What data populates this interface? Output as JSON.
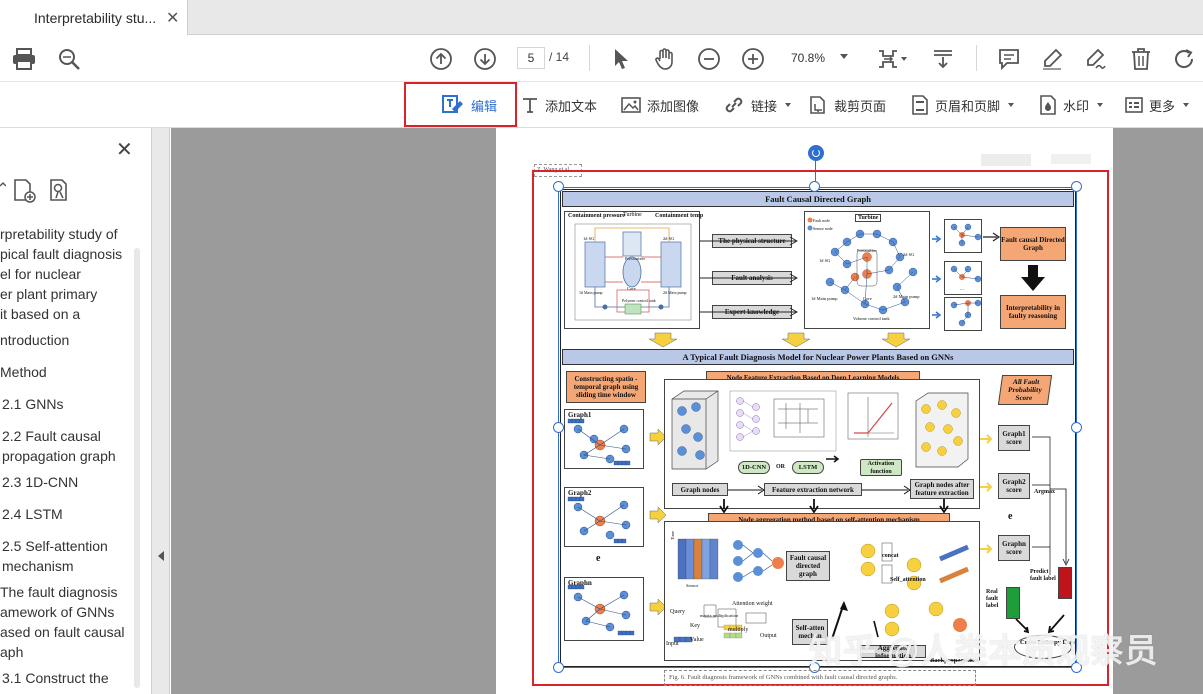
{
  "tab": {
    "title": "Interpretability stu...",
    "close_glyph": "✕"
  },
  "toolbar": {
    "current_page": "5",
    "total_pages": "/ 14",
    "zoom": "70.8%",
    "icons": [
      "print-icon",
      "zoom-search-icon",
      "page-up-icon",
      "page-down-icon",
      "select-cursor-icon",
      "hand-tool-icon",
      "zoom-out-icon",
      "zoom-in-icon",
      "fit-page-icon",
      "scroll-mode-icon",
      "comment-icon",
      "highlight-icon",
      "sign-icon",
      "delete-icon",
      "rotate-icon"
    ]
  },
  "edit_toolbar": {
    "edit": "编辑",
    "add_text": "添加文本",
    "add_image": "添加图像",
    "link": "链接",
    "crop": "裁剪页面",
    "header_footer": "页眉和页脚",
    "watermark": "水印",
    "more": "更多",
    "highlight_color": "#d8232a"
  },
  "left_panel": {
    "close_glyph": "✕",
    "bookmarks": [
      "rpretability study of",
      "pical fault diagnosis",
      "el for nuclear",
      "er plant primary",
      "it based on a",
      "ntroduction",
      "Method",
      "2.1 GNNs",
      "2.2 Fault causal",
      "propagation graph",
      "2.3 1D-CNN",
      "2.4 LSTM",
      "2.5 Self-attention",
      "mechanism",
      "The fault diagnosis",
      "amework of GNNs",
      "ased on fault causal",
      "aph",
      "3.1 Construct the"
    ]
  },
  "figure": {
    "author_tag": "Z. Wang et al.",
    "section1_title": "Fault Causal Directed Graph",
    "section2_title": "A Typical Fault Diagnosis Model for Nuclear Power Plants Based on GNNs",
    "containment_pressure": "Containment pressure",
    "containment_temp": "Containment temp",
    "turbine_left": "Turbine",
    "pressurizer": "Pressurizer",
    "core": "Core",
    "polymer_control_tank": "Polymer control tank",
    "sg_left": "1# SG",
    "sg_right": "2# SG",
    "main_pump_left": "1# Main pump",
    "main_pump_right": "2# Main pump",
    "physical_structure": "The physical structure",
    "fault_analysis": "Fault analysis",
    "expert_knowledge": "Expert knowledge",
    "turbine": "Turbine",
    "fault_node": "Fault node",
    "sensor_node": "Sensor node",
    "pressurizer2": "Pressurizer",
    "sg1": "1# SG",
    "sg2": "2# SG",
    "main_pump1": "1# Main pump",
    "core2": "Core",
    "main_pump2": "2# Main pump",
    "volume_control_tank": "Volume control tank",
    "fault_causal_directed_graph": "Fault causal Directed Graph",
    "interpretability": "Interpretability in faulty reasoning",
    "sliding_window": "Constructing spatio - temporal graph using sliding time window",
    "node_feature_extraction": "Node Feature Extraction Based on Deep Learning Models",
    "all_fault_prob": "All Fault Probability Score",
    "graph1": "Graph1",
    "graph2": "Graph2",
    "graphn": "Graphn",
    "ellipsis": "e",
    "cnn": "1D-CNN",
    "or": "OR",
    "lstm": "LSTM",
    "activation": "Activation function",
    "graph_nodes": "Graph nodes",
    "feature_extraction_network": "Feature extraction network",
    "graph_nodes_after": "Graph nodes after feature extraction",
    "node_aggregation": "Node aggregation method based on self-attention mechanism",
    "graph1_score": "Graph1 score",
    "graph2_score": "Graph2 score",
    "graphn_score": "Graphn score",
    "argmax": "Argmax",
    "time": "Time",
    "sensor": "Sensor",
    "fault_causal_directed_graph2": "Fault causal directed graph",
    "concat": "concat",
    "self_attention": "Self_attention",
    "query": "Query",
    "key": "Key",
    "value": "Value",
    "input": "Input",
    "matrix_multiplication": "matrix multiplication",
    "multiply": "multiply",
    "attention_weight": "Attention weight",
    "output": "Output",
    "self_attention_mechanism": "Self-atten mechan",
    "aggregate": "Aggregate information",
    "backpropagation": "Backpropagation",
    "predict_fault_label": "Predict fault label",
    "real_fault_label": "Real fault label",
    "cross_entropy": "Cross-Entropy Loss",
    "caption": "Fig. 6. Fault diagnosis framework of GNNs combined with fault causal directed graphs."
  },
  "watermark_text": "知乎 @人类本质观察员",
  "colors": {
    "selection_blue": "#2f6fd0",
    "header_blue": "#b8c8e6",
    "orange_box": "#f4a675",
    "node_blue": "#5b8fd6",
    "node_orange": "#ef7f4a",
    "node_yellow": "#f6d03f",
    "predict_red": "#c0141c",
    "real_green": "#1e9e3a"
  }
}
